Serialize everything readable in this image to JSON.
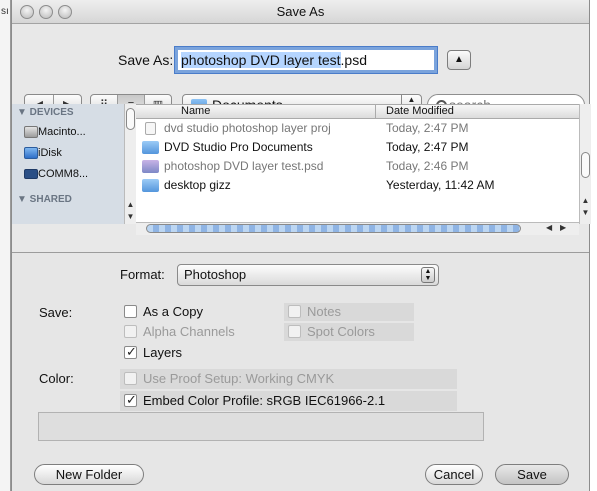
{
  "window": {
    "title": "Save As",
    "left_edge_fragment": "sı"
  },
  "header": {
    "save_as_label": "Save As:",
    "filename_selected": "photoshop DVD layer test",
    "filename_ext": ".psd",
    "expand_glyph": "▲"
  },
  "toolbar": {
    "back_glyph": "◀",
    "forward_glyph": "▶",
    "view_icons_glyph": "⠿",
    "view_list_glyph": "≡",
    "view_columns_glyph": "▥",
    "location": "Documents",
    "search_placeholder": "search"
  },
  "sidebar": {
    "devices_header": "▼ DEVICES",
    "shared_header": "▼ SHARED",
    "items": [
      {
        "label": "Macinto...",
        "icon": "hard-drive-icon"
      },
      {
        "label": "iDisk",
        "icon": "idisk-icon"
      },
      {
        "label": "COMM8...",
        "icon": "display-icon"
      }
    ]
  },
  "filelist": {
    "columns": [
      "Name",
      "Date Modified"
    ],
    "rows": [
      {
        "name": "dvd studio photoshop layer proj",
        "date": "Today, 2:47 PM",
        "dim": true,
        "icon": "document-icon"
      },
      {
        "name": "DVD Studio Pro Documents",
        "date": "Today, 2:47 PM",
        "dim": false,
        "icon": "folder-icon"
      },
      {
        "name": "photoshop DVD layer test.psd",
        "date": "Today, 2:46 PM",
        "dim": true,
        "icon": "psd-file-icon"
      },
      {
        "name": "desktop gizz",
        "date": "Yesterday, 11:42 AM",
        "dim": false,
        "icon": "folder-icon"
      }
    ]
  },
  "options": {
    "format_label": "Format:",
    "format_value": "Photoshop",
    "save_label": "Save:",
    "as_a_copy": "As a Copy",
    "notes": "Notes",
    "alpha_channels": "Alpha Channels",
    "spot_colors": "Spot Colors",
    "layers": "Layers",
    "color_label": "Color:",
    "use_proof_setup": "Use Proof Setup:  Working CMYK",
    "embed_color_profile": "Embed Color Profile:  sRGB IEC61966-2.1"
  },
  "buttons": {
    "new_folder": "New Folder",
    "cancel": "Cancel",
    "save": "Save"
  }
}
